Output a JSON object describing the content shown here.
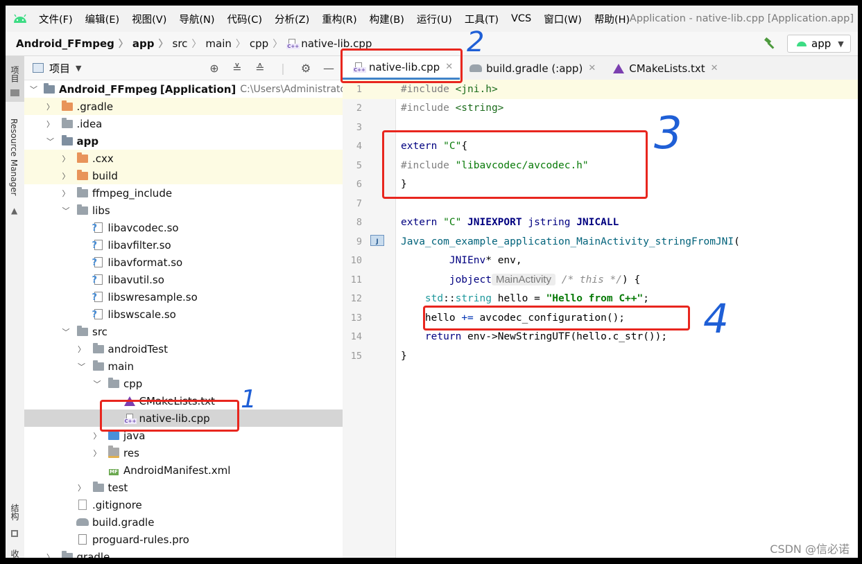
{
  "menu": [
    "文件(F)",
    "编辑(E)",
    "视图(V)",
    "导航(N)",
    "代码(C)",
    "分析(Z)",
    "重构(R)",
    "构建(B)",
    "运行(U)",
    "工具(T)",
    "VCS",
    "窗口(W)",
    "帮助(H)"
  ],
  "window_title": "Application - native-lib.cpp [Application.app]",
  "breadcrumb": [
    "Android_FFmpeg",
    "app",
    "src",
    "main",
    "cpp",
    "native-lib.cpp"
  ],
  "run_config": "app",
  "left_strip": {
    "project": "项目",
    "resource_manager": "Resource Manager",
    "structure": "结构",
    "favorites": "收"
  },
  "project_panel": {
    "title": "项目"
  },
  "tree": [
    {
      "depth": 0,
      "chev": "down",
      "icon": "module",
      "label": "Android_FFmpeg",
      "suffix": "[Application]",
      "path": "C:\\Users\\Administrator\\",
      "bold": true,
      "yellow": false
    },
    {
      "depth": 1,
      "chev": "right",
      "icon": "folder-orange",
      "label": ".gradle",
      "yellow": true
    },
    {
      "depth": 1,
      "chev": "right",
      "icon": "folder",
      "label": ".idea",
      "yellow": false
    },
    {
      "depth": 1,
      "chev": "down",
      "icon": "module",
      "label": "app",
      "bold": true,
      "yellow": false
    },
    {
      "depth": 2,
      "chev": "right",
      "icon": "folder-orange",
      "label": ".cxx",
      "yellow": true
    },
    {
      "depth": 2,
      "chev": "right",
      "icon": "folder-orange",
      "label": "build",
      "yellow": true
    },
    {
      "depth": 2,
      "chev": "right",
      "icon": "folder",
      "label": "ffmpeg_include",
      "yellow": false
    },
    {
      "depth": 2,
      "chev": "down",
      "icon": "folder",
      "label": "libs",
      "yellow": false
    },
    {
      "depth": 3,
      "chev": "none",
      "icon": "so",
      "label": "libavcodec.so"
    },
    {
      "depth": 3,
      "chev": "none",
      "icon": "so",
      "label": "libavfilter.so"
    },
    {
      "depth": 3,
      "chev": "none",
      "icon": "so",
      "label": "libavformat.so"
    },
    {
      "depth": 3,
      "chev": "none",
      "icon": "so",
      "label": "libavutil.so"
    },
    {
      "depth": 3,
      "chev": "none",
      "icon": "so",
      "label": "libswresample.so"
    },
    {
      "depth": 3,
      "chev": "none",
      "icon": "so",
      "label": "libswscale.so"
    },
    {
      "depth": 2,
      "chev": "down",
      "icon": "folder",
      "label": "src"
    },
    {
      "depth": 3,
      "chev": "right",
      "icon": "folder",
      "label": "androidTest"
    },
    {
      "depth": 3,
      "chev": "down",
      "icon": "folder",
      "label": "main"
    },
    {
      "depth": 4,
      "chev": "down",
      "icon": "folder",
      "label": "cpp"
    },
    {
      "depth": 5,
      "chev": "none",
      "icon": "cmake",
      "label": "CMakeLists.txt"
    },
    {
      "depth": 5,
      "chev": "none",
      "icon": "cpp",
      "label": "native-lib.cpp",
      "selected": true
    },
    {
      "depth": 4,
      "chev": "right",
      "icon": "folder-blue",
      "label": "java"
    },
    {
      "depth": 4,
      "chev": "right",
      "icon": "folder-res",
      "label": "res"
    },
    {
      "depth": 4,
      "chev": "none",
      "icon": "manifest",
      "label": "AndroidManifest.xml"
    },
    {
      "depth": 3,
      "chev": "right",
      "icon": "folder",
      "label": "test"
    },
    {
      "depth": 2,
      "chev": "none",
      "icon": "gitignore",
      "label": ".gitignore"
    },
    {
      "depth": 2,
      "chev": "none",
      "icon": "gradle",
      "label": "build.gradle"
    },
    {
      "depth": 2,
      "chev": "none",
      "icon": "file",
      "label": "proguard-rules.pro"
    },
    {
      "depth": 1,
      "chev": "right",
      "icon": "folder",
      "label": "gradle"
    }
  ],
  "tabs": [
    {
      "label": "native-lib.cpp",
      "icon": "cpp",
      "active": true
    },
    {
      "label": "build.gradle (:app)",
      "icon": "gradle",
      "active": false
    },
    {
      "label": "CMakeLists.txt",
      "icon": "cmake",
      "active": false
    }
  ],
  "code": [
    {
      "n": "1",
      "hl": true,
      "tokens": [
        [
          "pp",
          "#include "
        ],
        [
          "hdr",
          "<jni.h>"
        ]
      ]
    },
    {
      "n": "2",
      "tokens": [
        [
          "pp",
          "#include "
        ],
        [
          "hdr",
          "<string>"
        ]
      ]
    },
    {
      "n": "3",
      "tokens": []
    },
    {
      "n": "4",
      "tokens": [
        [
          "kw",
          "extern "
        ],
        [
          "str",
          "\"C\""
        ],
        [
          "plain",
          "{"
        ]
      ]
    },
    {
      "n": "5",
      "tokens": [
        [
          "pp",
          "#include "
        ],
        [
          "str",
          "\"libavcodec/avcodec.h\""
        ]
      ]
    },
    {
      "n": "6",
      "tokens": [
        [
          "plain",
          "}"
        ]
      ]
    },
    {
      "n": "7",
      "tokens": []
    },
    {
      "n": "8",
      "tokens": [
        [
          "kw",
          "extern "
        ],
        [
          "str",
          "\"C\" "
        ],
        [
          "kwb",
          "JNIEXPORT "
        ],
        [
          "kw",
          "jstring "
        ],
        [
          "kwb",
          "JNICALL"
        ]
      ]
    },
    {
      "n": "9",
      "tokens": [
        [
          "fn",
          "Java_com_example_application_MainActivity_stringFromJNI"
        ],
        [
          "plain",
          "("
        ]
      ]
    },
    {
      "n": "10",
      "tokens": [
        [
          "plain",
          "        "
        ],
        [
          "kw",
          "JNIEnv"
        ],
        [
          "plain",
          "* env,"
        ]
      ]
    },
    {
      "n": "11",
      "tokens": [
        [
          "plain",
          "        "
        ],
        [
          "kw",
          "jobject"
        ],
        [
          "hint",
          "MainActivity"
        ],
        [
          "plain",
          " "
        ],
        [
          "cm",
          "/* this */"
        ],
        [
          "plain",
          ") {"
        ]
      ]
    },
    {
      "n": "12",
      "tokens": [
        [
          "plain",
          "    "
        ],
        [
          "ty",
          "std"
        ],
        [
          "plain",
          "::"
        ],
        [
          "ty",
          "string"
        ],
        [
          "plain",
          " hello = "
        ],
        [
          "strb",
          "\"Hello from C++\""
        ],
        [
          "plain",
          ";"
        ]
      ]
    },
    {
      "n": "13",
      "tokens": [
        [
          "plain",
          "    hello "
        ],
        [
          "op",
          "+="
        ],
        [
          "plain",
          " avcodec_configuration();"
        ]
      ]
    },
    {
      "n": "14",
      "tokens": [
        [
          "plain",
          "    "
        ],
        [
          "kw",
          "return"
        ],
        [
          "plain",
          " env->NewStringUTF(hello.c_str());"
        ]
      ]
    },
    {
      "n": "15",
      "tokens": [
        [
          "plain",
          "}"
        ]
      ]
    }
  ],
  "annotations": [
    "1",
    "2",
    "3",
    "4"
  ],
  "watermark": "CSDN @信必诺",
  "colors": {
    "annotation_red": "#e8261e",
    "annotation_blue": "#1f5fd6",
    "tab_underline": "#4083c9"
  }
}
